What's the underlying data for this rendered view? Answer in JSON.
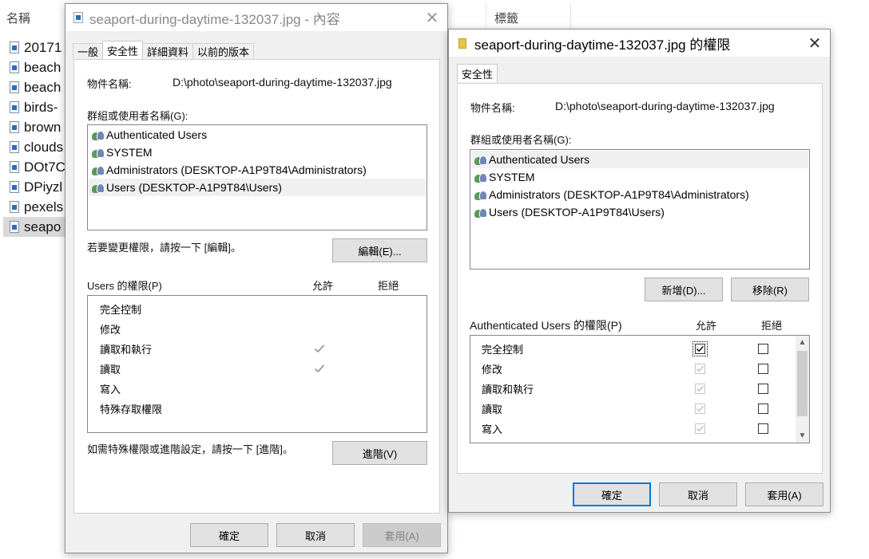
{
  "explorer": {
    "col_name": "名稱",
    "col_tags": "標籤",
    "files": [
      "20171",
      "beach",
      "beach",
      "birds-",
      "brown",
      "clouds",
      "DOt7C",
      "DPiyzl",
      "pexels",
      "seapo"
    ]
  },
  "props_dialog": {
    "title": "seaport-during-daytime-132037.jpg - 內容",
    "tabs": [
      "一般",
      "安全性",
      "詳細資料",
      "以前的版本"
    ],
    "object_label": "物件名稱:",
    "object_value": "D:\\photo\\seaport-during-daytime-132037.jpg",
    "group_label": "群組或使用者名稱(G):",
    "users": [
      "Authenticated Users",
      "SYSTEM",
      "Administrators (DESKTOP-A1P9T84\\Administrators)",
      "Users (DESKTOP-A1P9T84\\Users)"
    ],
    "change_hint": "若要變更權限，請按一下 [編輯]。",
    "edit_button": "編輯(E)...",
    "perm_label": "Users 的權限(P)",
    "allow_label": "允許",
    "deny_label": "拒絕",
    "permissions": [
      "完全控制",
      "修改",
      "讀取和執行",
      "讀取",
      "寫入",
      "特殊存取權限"
    ],
    "advanced_hint": "如需特殊權限或進階設定，請按一下 [進階]。",
    "advanced_button": "進階(V)",
    "ok_button": "確定",
    "cancel_button": "取消",
    "apply_button": "套用(A)"
  },
  "perm_dialog": {
    "title": "seaport-during-daytime-132037.jpg 的權限",
    "tab": "安全性",
    "object_label": "物件名稱:",
    "object_value": "D:\\photo\\seaport-during-daytime-132037.jpg",
    "group_label": "群組或使用者名稱(G):",
    "users": [
      "Authenticated Users",
      "SYSTEM",
      "Administrators (DESKTOP-A1P9T84\\Administrators)",
      "Users (DESKTOP-A1P9T84\\Users)"
    ],
    "add_button": "新增(D)...",
    "remove_button": "移除(R)",
    "perm_label": "Authenticated Users 的權限(P)",
    "allow_label": "允許",
    "deny_label": "拒絕",
    "permissions": [
      "完全控制",
      "修改",
      "讀取和執行",
      "讀取",
      "寫入"
    ],
    "ok_button": "確定",
    "cancel_button": "取消",
    "apply_button": "套用(A)"
  },
  "colors": {
    "accent": "#0078d7",
    "dialog_bg": "#f0f0f0",
    "selection": "#d9d9d9"
  }
}
